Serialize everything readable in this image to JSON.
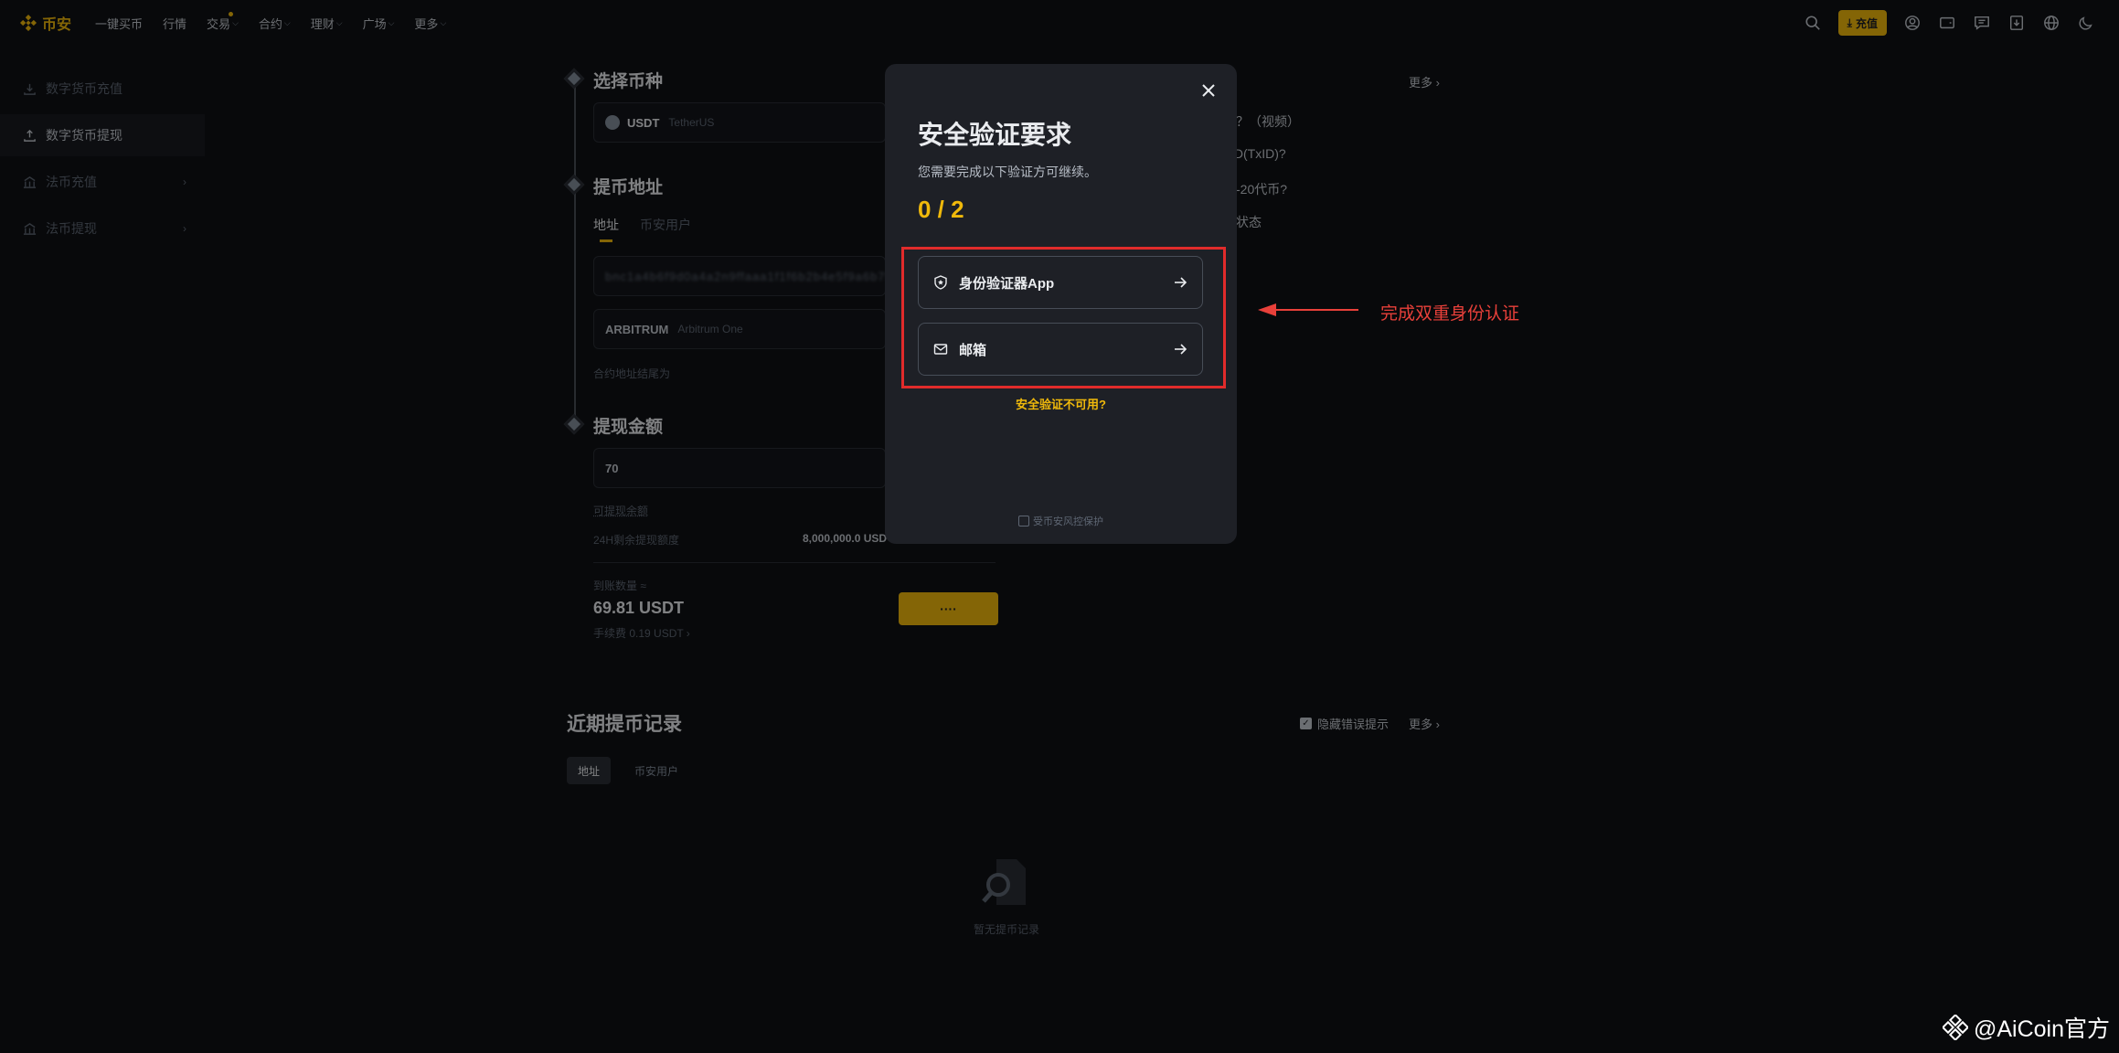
{
  "header": {
    "logo_text": "币安",
    "nav": [
      {
        "label": "一键买币",
        "chevron": false
      },
      {
        "label": "行情",
        "chevron": false
      },
      {
        "label": "交易",
        "chevron": true
      },
      {
        "label": "合约",
        "chevron": true
      },
      {
        "label": "理财",
        "chevron": true
      },
      {
        "label": "广场",
        "chevron": true
      },
      {
        "label": "更多",
        "chevron": true
      }
    ],
    "deposit_label": "充值",
    "icons": [
      "search-icon",
      "user-icon",
      "wallet-icon",
      "message-icon",
      "download-icon",
      "globe-icon",
      "moon-icon"
    ]
  },
  "sidebar": {
    "items": [
      {
        "label": "数字货币充值",
        "icon": "download-icon",
        "active": false
      },
      {
        "label": "数字货币提现",
        "icon": "upload-icon",
        "active": true
      },
      {
        "label": "法币充值",
        "icon": "bank-icon",
        "active": false,
        "chevron": true
      },
      {
        "label": "法币提现",
        "icon": "bank-icon",
        "active": false,
        "chevron": true
      }
    ]
  },
  "main": {
    "step1": {
      "title": "选择币种",
      "coin": "USDT",
      "coin_name": "TetherUS"
    },
    "step2": {
      "title": "提币地址",
      "tabs": [
        "地址",
        "币安用户"
      ],
      "address_placeholder_blur": "bnc1a4b6f9d0a4a2n9ffaaa1f1f6b2b4e5f9a6b7f",
      "network": "ARBITRUM",
      "network_name": "Arbitrum One",
      "contract_note": "合约地址结尾为"
    },
    "step3": {
      "title": "提现金额",
      "amount": "70",
      "available_label": "可提现余额",
      "limit_label": "24H剩余提现额度",
      "limit_value": "8,000,000.0 USD",
      "receive_label": "到账数量 ≈",
      "receive_value": "69.81 USDT",
      "fee_text": "手续费 0.19 USDT  ›"
    },
    "right_more": "更多",
    "right_links": [
      "？（视频）",
      "ID(TxID)?",
      "-20代币?",
      "状态"
    ],
    "withdraw_button": "····"
  },
  "history": {
    "title": "近期提币记录",
    "hide_errors_label": "隐藏错误提示",
    "more": "更多",
    "tabs": [
      "地址",
      "币安用户"
    ],
    "empty_text": "暂无提币记录"
  },
  "modal": {
    "title": "安全验证要求",
    "subtitle": "您需要完成以下验证方可继续。",
    "count": "0 / 2",
    "options": [
      {
        "label": "身份验证器App",
        "icon": "shield-star-icon"
      },
      {
        "label": "邮箱",
        "icon": "mail-icon"
      }
    ],
    "unavailable_link": "安全验证不可用?",
    "footer": "受币安风控保护"
  },
  "annotation": {
    "text": "完成双重身份认证",
    "color": "#e8403a"
  },
  "watermark": {
    "text": "@AiCoin官方"
  },
  "colors": {
    "accent": "#f0b90b",
    "background": "#0f1114",
    "modal": "#1e2026",
    "highlight_box": "#e12b2b"
  }
}
